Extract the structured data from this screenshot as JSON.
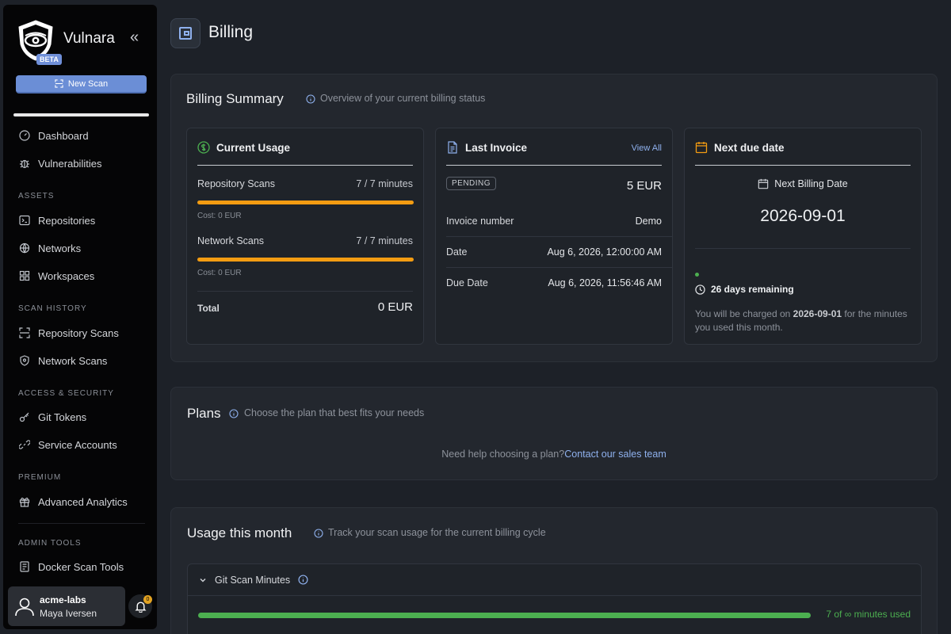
{
  "brand": {
    "name": "Vulnara",
    "badge": "BETA"
  },
  "sidebar": {
    "new_scan": "New Scan",
    "items": [
      {
        "label": "Dashboard"
      },
      {
        "label": "Vulnerabilities"
      }
    ],
    "sections": [
      {
        "label": "ASSETS",
        "items": [
          "Repositories",
          "Networks",
          "Workspaces"
        ]
      },
      {
        "label": "SCAN HISTORY",
        "items": [
          "Repository Scans",
          "Network Scans"
        ]
      },
      {
        "label": "ACCESS & SECURITY",
        "items": [
          "Git Tokens",
          "Service Accounts"
        ]
      },
      {
        "label": "PREMIUM",
        "items": [
          "Advanced Analytics"
        ]
      },
      {
        "label": "ADMIN TOOLS",
        "items": [
          "Docker Scan Tools"
        ]
      }
    ],
    "user": {
      "org": "acme-labs",
      "name": "Maya Iversen"
    },
    "notifications": "0"
  },
  "header": {
    "title": "Billing"
  },
  "billing_summary": {
    "title": "Billing Summary",
    "subtitle": "Overview of your current billing status",
    "current_usage": {
      "title": "Current Usage",
      "rows": [
        {
          "label": "Repository Scans",
          "value": "7 / 7 minutes",
          "cost": "Cost: 0 EUR",
          "fill": 1.0
        },
        {
          "label": "Network Scans",
          "value": "7 / 7 minutes",
          "cost": "Cost: 0 EUR",
          "fill": 1.0
        }
      ],
      "total_label": "Total",
      "total_value": "0 EUR"
    },
    "last_invoice": {
      "title": "Last Invoice",
      "view_all": "View All",
      "status": "PENDING",
      "amount": "5 EUR",
      "rows": [
        {
          "label": "Invoice number",
          "value": "Demo"
        },
        {
          "label": "Date",
          "value": "Aug 6, 2026, 12:00:00 AM"
        },
        {
          "label": "Due Date",
          "value": "Aug 6, 2026, 11:56:46 AM"
        }
      ]
    },
    "next_due": {
      "title": "Next due date",
      "billing_label": "Next Billing Date",
      "date": "2026-09-01",
      "remaining": "26 days remaining",
      "charged_prefix": "You will be charged on ",
      "charged_date": "2026-09-01",
      "charged_suffix": " for the minutes you used this month."
    }
  },
  "plans": {
    "title": "Plans",
    "subtitle": "Choose the plan that best fits your needs",
    "help_text": "Need help choosing a plan?",
    "help_link": "Contact our sales team"
  },
  "usage": {
    "title": "Usage this month",
    "subtitle": "Track your scan usage for the current billing cycle",
    "git_scan": {
      "label": "Git Scan Minutes",
      "used_text": "7 of ∞ minutes used"
    }
  },
  "colors": {
    "accent": "#6b8ed6",
    "warning": "#f39c12",
    "success": "#4caf50"
  }
}
